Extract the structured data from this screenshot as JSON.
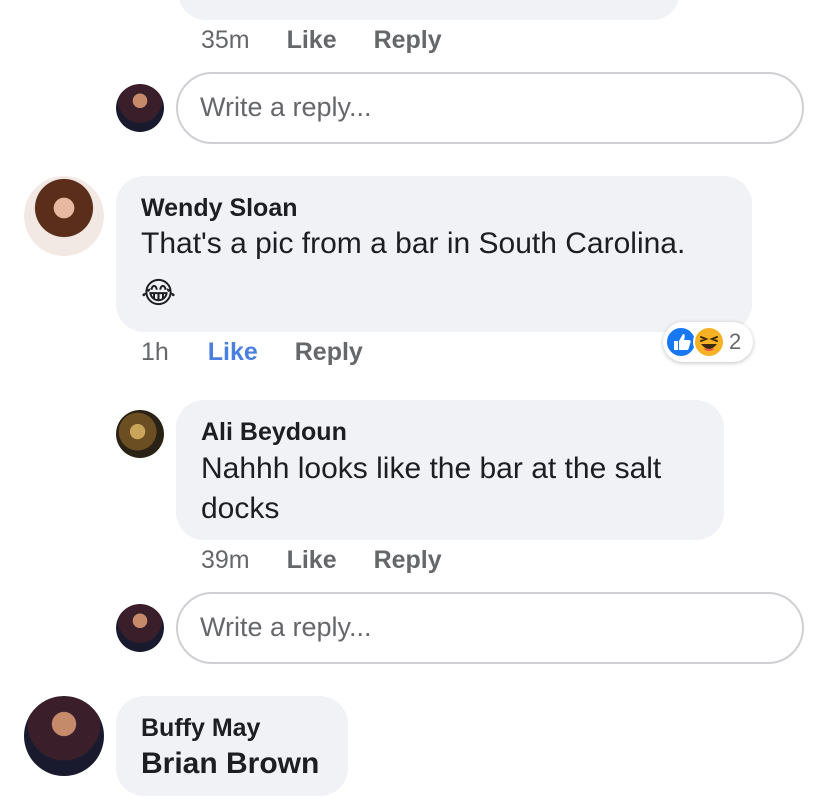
{
  "top_comment": {
    "time": "35m",
    "like_label": "Like",
    "reply_label": "Reply"
  },
  "reply_box_1": {
    "placeholder": "Write a reply..."
  },
  "comment_wendy": {
    "author": "Wendy Sloan",
    "text": "That's a pic from a bar in South Carolina.",
    "emoji": "😂",
    "time": "1h",
    "like_label": "Like",
    "reply_label": "Reply",
    "reaction_count": "2",
    "reactions": [
      "like-icon",
      "haha-icon"
    ],
    "liked_color": "#4a7fe0"
  },
  "reply_ali": {
    "author": "Ali Beydoun",
    "text": "Nahhh looks like the bar at the salt docks",
    "time": "39m",
    "like_label": "Like",
    "reply_label": "Reply"
  },
  "reply_box_2": {
    "placeholder": "Write a reply..."
  },
  "comment_buffy": {
    "author": "Buffy May",
    "text": "Brian Brown"
  }
}
